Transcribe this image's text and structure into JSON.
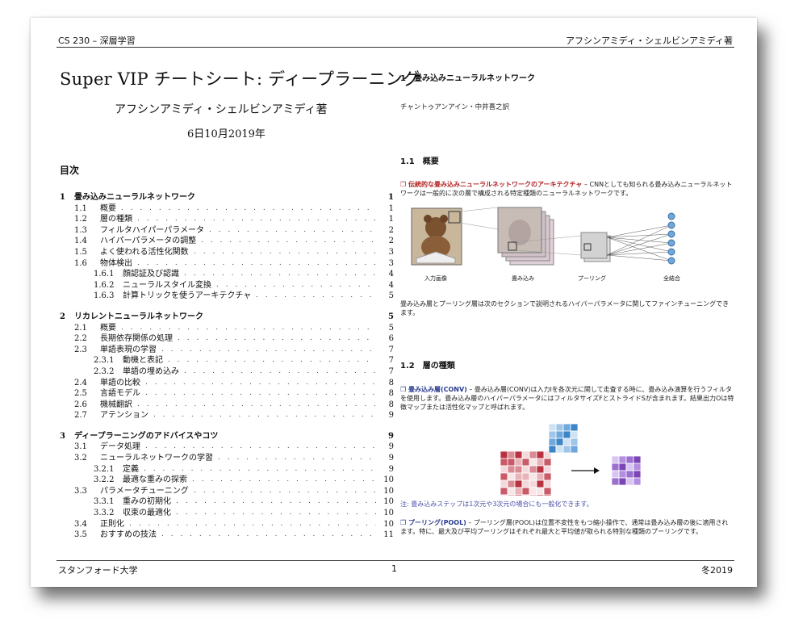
{
  "header": {
    "left": "CS 230 – 深層学習",
    "right": "アフシンアミディ・シェルビンアミディ著"
  },
  "title": "Super VIP チートシート: ディープラーニング",
  "author": "アフシンアミディ・シェルビンアミディ著",
  "date": "6日10月2019年",
  "toc": {
    "heading": "目次",
    "sections": [
      {
        "num": "1",
        "title": "畳み込みニューラルネットワーク",
        "page": "1",
        "items": [
          {
            "num": "1.1",
            "title": "概要",
            "page": "1",
            "level": 1
          },
          {
            "num": "1.2",
            "title": "層の種類",
            "page": "1",
            "level": 1
          },
          {
            "num": "1.3",
            "title": "フィルタハイパーパラメータ",
            "page": "2",
            "level": 1
          },
          {
            "num": "1.4",
            "title": "ハイパーパラメータの調整",
            "page": "2",
            "level": 1
          },
          {
            "num": "1.5",
            "title": "よく使われる活性化関数",
            "page": "3",
            "level": 1
          },
          {
            "num": "1.6",
            "title": "物体検出",
            "page": "3",
            "level": 1
          },
          {
            "num": "1.6.1",
            "title": "顔認証及び認識",
            "page": "4",
            "level": 2
          },
          {
            "num": "1.6.2",
            "title": "ニューラルスタイル変換",
            "page": "4",
            "level": 2
          },
          {
            "num": "1.6.3",
            "title": "計算トリックを使うアーキテクチャ",
            "page": "5",
            "level": 2
          }
        ]
      },
      {
        "num": "2",
        "title": "リカレントニューラルネットワーク",
        "page": "5",
        "items": [
          {
            "num": "2.1",
            "title": "概要",
            "page": "5",
            "level": 1
          },
          {
            "num": "2.2",
            "title": "長期依存関係の処理",
            "page": "6",
            "level": 1
          },
          {
            "num": "2.3",
            "title": "単語表現の学習",
            "page": "7",
            "level": 1
          },
          {
            "num": "2.3.1",
            "title": "動機と表記",
            "page": "7",
            "level": 2
          },
          {
            "num": "2.3.2",
            "title": "単語の埋め込み",
            "page": "7",
            "level": 2
          },
          {
            "num": "2.4",
            "title": "単語の比較",
            "page": "8",
            "level": 1
          },
          {
            "num": "2.5",
            "title": "言語モデル",
            "page": "8",
            "level": 1
          },
          {
            "num": "2.6",
            "title": "機械翻訳",
            "page": "8",
            "level": 1
          },
          {
            "num": "2.7",
            "title": "アテンション",
            "page": "9",
            "level": 1
          }
        ]
      },
      {
        "num": "3",
        "title": "ディープラーニングのアドバイスやコツ",
        "page": "9",
        "items": [
          {
            "num": "3.1",
            "title": "データ処理",
            "page": "9",
            "level": 1
          },
          {
            "num": "3.2",
            "title": "ニューラルネットワークの学習",
            "page": "9",
            "level": 1
          },
          {
            "num": "3.2.1",
            "title": "定義",
            "page": "9",
            "level": 2
          },
          {
            "num": "3.2.2",
            "title": "最適な重みの探索",
            "page": "10",
            "level": 2
          },
          {
            "num": "3.3",
            "title": "パラメータチューニング",
            "page": "10",
            "level": 1
          },
          {
            "num": "3.3.1",
            "title": "重みの初期化",
            "page": "10",
            "level": 2
          },
          {
            "num": "3.3.2",
            "title": "収束の最適化",
            "page": "10",
            "level": 2
          },
          {
            "num": "3.4",
            "title": "正則化",
            "page": "10",
            "level": 1
          },
          {
            "num": "3.5",
            "title": "おすすめの技法",
            "page": "11",
            "level": 1
          }
        ]
      }
    ]
  },
  "right": {
    "section1": "1　畳み込みニューラルネットワーク",
    "translators": "チャントゥアンアイン・中井喜之訳",
    "sub11": "1.1　概要",
    "p1_lead": "❒ 伝統的な畳み込みニューラルネットワークのアーキテクチャ",
    "p1_body": " – CNNとしても知られる畳み込みニューラルネットワークは一般的に次の層で構成される特定種類のニューラルネットワークです。",
    "fig1_labels": [
      "入力画像",
      "畳み込み",
      "プーリング",
      "全結合"
    ],
    "p2": "畳み込み層とプーリング層は次のセクションで説明されるハイパーパラメータに関してファインチューニングできます。",
    "sub12": "1.2　層の種類",
    "p3_lead": "❒ 畳み込み層(CONV)",
    "p3_body": " – 畳み込み層(CONV)は入力Iを各次元に関して走査する時に、畳み込み演算を行うフィルタを使用します。畳み込み層のハイパーパラメータにはフィルタサイズFとストライドSが含まれます。結果出力Oは特徴マップまたは活性化マップと呼ばれます。",
    "note": "注: 畳み込みステップは1次元や3次元の場合にも一般化できます。",
    "p4_lead": "❒ プーリング(POOL)",
    "p4_body": " – プーリング層(POOL)は位置不変性をもつ縮小操作で、通常は畳み込み層の後に適用されます。特に、最大及び平均プーリングはそれぞれ最大と平均値が取られる特別な種類のプーリングです。"
  },
  "footer": {
    "left": "スタンフォード大学",
    "center": "1",
    "right": "冬2019"
  },
  "colors": {
    "accent_red": "#b22222",
    "accent_navy": "#2a3b8f",
    "note_blue": "#4b4fa8"
  }
}
